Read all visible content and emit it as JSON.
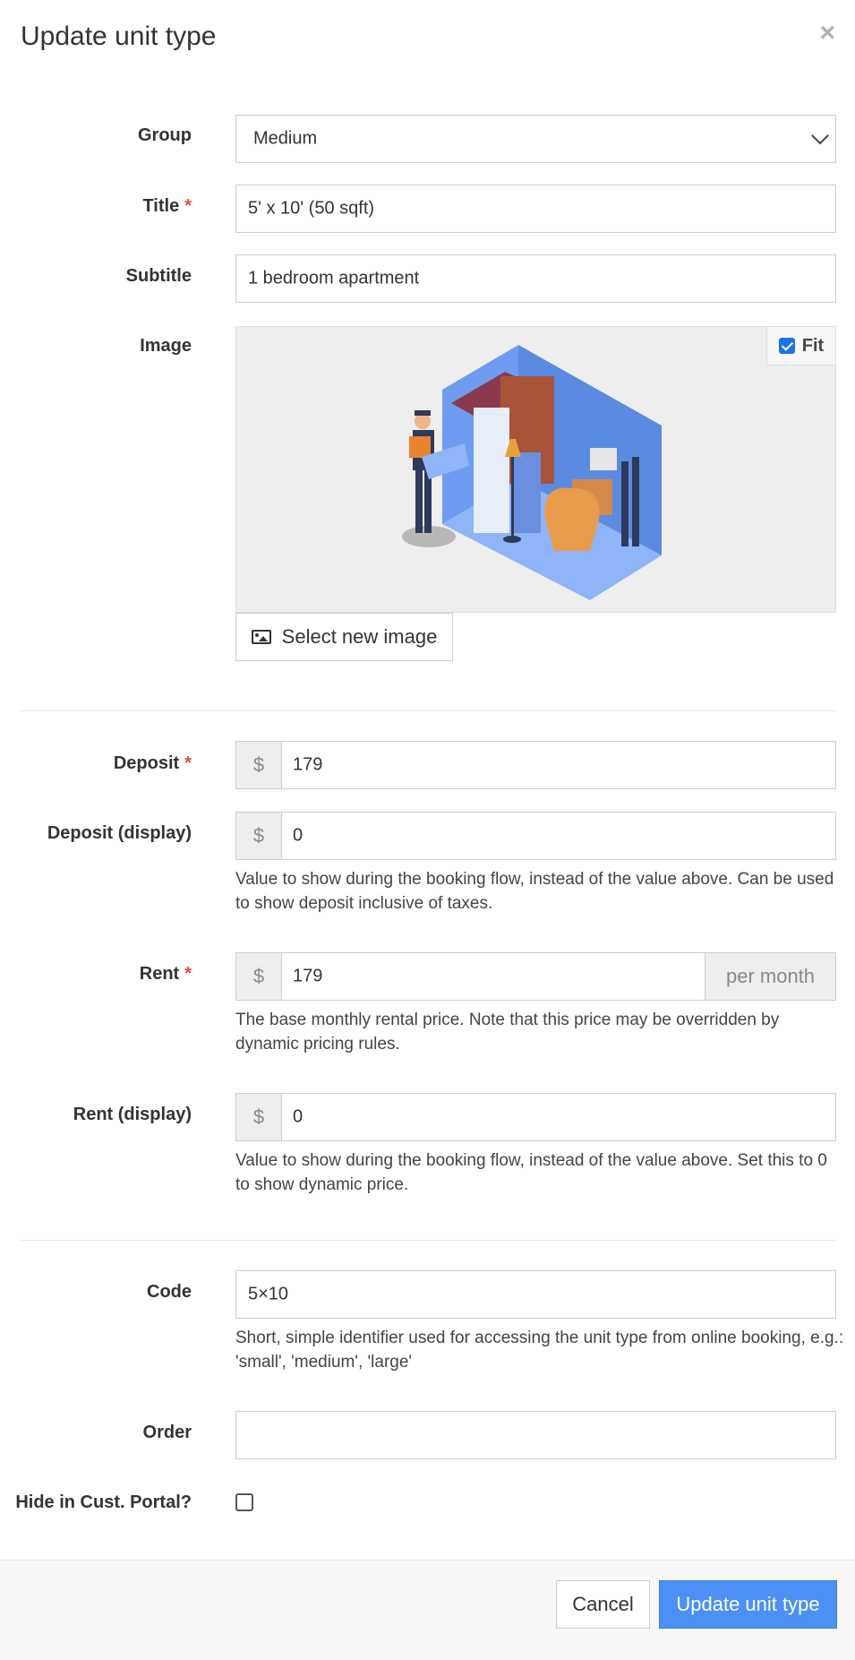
{
  "modal": {
    "title": "Update unit type",
    "close_label": "×"
  },
  "fields": {
    "group": {
      "label": "Group",
      "value": "Medium"
    },
    "title": {
      "label": "Title",
      "required": "*",
      "value": "5' x 10' (50 sqft)"
    },
    "subtitle": {
      "label": "Subtitle",
      "value": "1 bedroom apartment"
    },
    "image": {
      "label": "Image",
      "fit_label": "Fit",
      "fit_checked": true,
      "select_button": "Select new image"
    },
    "deposit": {
      "label": "Deposit",
      "required": "*",
      "prefix": "$",
      "value": "179"
    },
    "deposit_display": {
      "label": "Deposit (display)",
      "prefix": "$",
      "value": "0",
      "help": "Value to show during the booking flow, instead of the value above. Can be used to show deposit inclusive of taxes."
    },
    "rent": {
      "label": "Rent",
      "required": "*",
      "prefix": "$",
      "value": "179",
      "suffix": "per month",
      "help": "The base monthly rental price. Note that this price may be overridden by dynamic pricing rules."
    },
    "rent_display": {
      "label": "Rent (display)",
      "prefix": "$",
      "value": "0",
      "help": "Value to show during the booking flow, instead of the value above. Set this to 0 to show dynamic price."
    },
    "code": {
      "label": "Code",
      "value": "5×10",
      "help": "Short, simple identifier used for accessing the unit type from online booking, e.g.: 'small', 'medium', 'large'"
    },
    "order": {
      "label": "Order",
      "value": ""
    },
    "hide_portal": {
      "label": "Hide in Cust. Portal?",
      "checked": false
    }
  },
  "footer": {
    "cancel": "Cancel",
    "submit": "Update unit type"
  },
  "colors": {
    "primary": "#4c8ff5",
    "required": "#e74c3c",
    "checkbox": "#1a73e8"
  },
  "icons": {
    "close": "close-icon",
    "select_image": "image-icon",
    "group_select": "chevron-down-icon"
  }
}
